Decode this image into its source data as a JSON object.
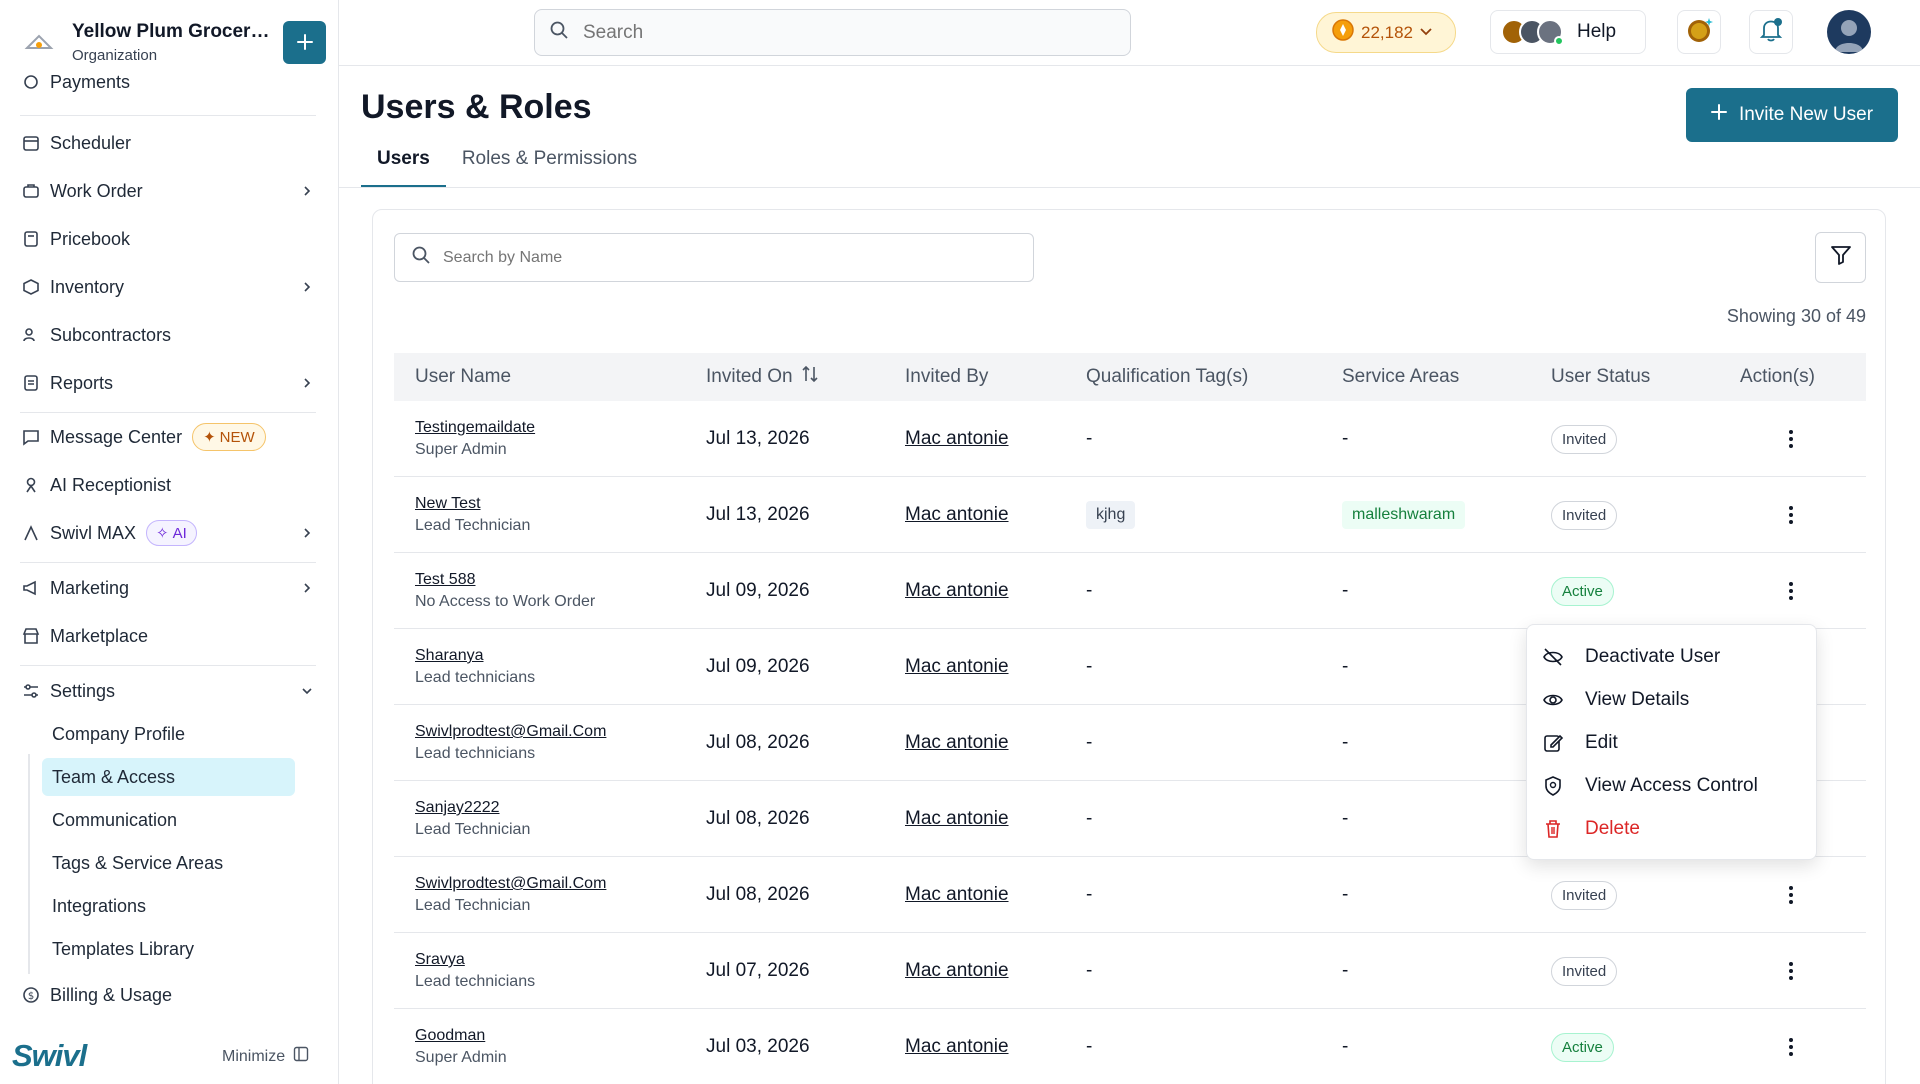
{
  "org": {
    "name": "Yellow Plum Grocers...",
    "sub": "Organization"
  },
  "nav": {
    "payments": "Payments",
    "scheduler": "Scheduler",
    "work_order": "Work Order",
    "pricebook": "Pricebook",
    "inventory": "Inventory",
    "subcontractors": "Subcontractors",
    "reports": "Reports",
    "message_center": "Message Center",
    "new_badge": "NEW",
    "ai_receptionist": "AI Receptionist",
    "swivl_max": "Swivl MAX",
    "ai_badge": "AI",
    "marketing": "Marketing",
    "marketplace": "Marketplace",
    "settings": "Settings",
    "settings_items": [
      "Company Profile",
      "Team & Access",
      "Communication",
      "Tags & Service Areas",
      "Integrations",
      "Templates Library"
    ],
    "billing": "Billing & Usage"
  },
  "brand": "Swivl",
  "minimize": "Minimize",
  "topbar": {
    "search_placeholder": "Search",
    "coins": "22,182",
    "help": "Help"
  },
  "page": {
    "title": "Users & Roles",
    "invite_button": "Invite New User",
    "tabs": [
      "Users",
      "Roles & Permissions"
    ],
    "search_placeholder": "Search by Name",
    "showing": "Showing 30 of 49"
  },
  "table": {
    "headers": [
      "User Name",
      "Invited On",
      "Invited By",
      "Qualification Tag(s)",
      "Service Areas",
      "User Status",
      "Action(s)"
    ],
    "rows": [
      {
        "name": "Testingemaildate",
        "role": "Super Admin",
        "date": "Jul 13, 2026",
        "by": "Mac antonie",
        "tags": "-",
        "areas": "-",
        "status": "Invited"
      },
      {
        "name": "New Test",
        "role": "Lead Technician",
        "date": "Jul 13, 2026",
        "by": "Mac antonie",
        "tags": "kjhg",
        "areas": "malleshwaram",
        "status": "Invited"
      },
      {
        "name": "Test 588",
        "role": "No Access to Work Order",
        "date": "Jul 09, 2026",
        "by": "Mac antonie",
        "tags": "-",
        "areas": "-",
        "status": "Active"
      },
      {
        "name": "Sharanya",
        "role": "Lead technicians",
        "date": "Jul 09, 2026",
        "by": "Mac antonie",
        "tags": "-",
        "areas": "-",
        "status": ""
      },
      {
        "name": "Swivlprodtest@Gmail.Com",
        "role": "Lead technicians",
        "date": "Jul 08, 2026",
        "by": "Mac antonie",
        "tags": "-",
        "areas": "-",
        "status": ""
      },
      {
        "name": "Sanjay2222",
        "role": "Lead Technician",
        "date": "Jul 08, 2026",
        "by": "Mac antonie",
        "tags": "-",
        "areas": "-",
        "status": ""
      },
      {
        "name": "Swivlprodtest@Gmail.Com",
        "role": "Lead Technician",
        "date": "Jul 08, 2026",
        "by": "Mac antonie",
        "tags": "-",
        "areas": "-",
        "status": "Invited"
      },
      {
        "name": "Sravya",
        "role": "Lead technicians",
        "date": "Jul 07, 2026",
        "by": "Mac antonie",
        "tags": "-",
        "areas": "-",
        "status": "Invited"
      },
      {
        "name": "Goodman",
        "role": "Super Admin",
        "date": "Jul 03, 2026",
        "by": "Mac antonie",
        "tags": "-",
        "areas": "-",
        "status": "Active"
      }
    ]
  },
  "menu": [
    "Deactivate User",
    "View Details",
    "Edit",
    "View Access Control",
    "Delete"
  ],
  "colors": {
    "primary": "#1b6f8c",
    "active_nav": "#d7f4fb",
    "danger": "#dc2626",
    "active_status": "#15803d"
  },
  "icons": [
    "plus-icon",
    "search-icon",
    "coin-icon",
    "bell-icon",
    "filter-icon",
    "sort-icon",
    "kebab-icon",
    "eye-off-icon",
    "eye-icon",
    "edit-icon",
    "shield-icon",
    "trash-icon"
  ]
}
